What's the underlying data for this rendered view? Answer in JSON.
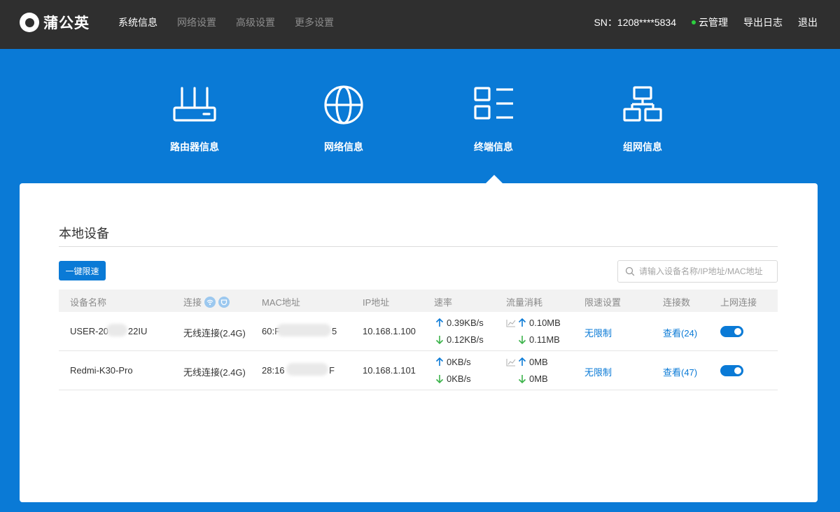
{
  "brand": {
    "name": "蒲公英"
  },
  "nav": [
    {
      "label": "系统信息",
      "active": true
    },
    {
      "label": "网络设置",
      "active": false
    },
    {
      "label": "高级设置",
      "active": false
    },
    {
      "label": "更多设置",
      "active": false
    }
  ],
  "top_right": {
    "sn": "SN：1208****5834",
    "cloud": "云管理",
    "export_log": "导出日志",
    "logout": "退出"
  },
  "categories": [
    {
      "label": "路由器信息",
      "icon": "router-icon"
    },
    {
      "label": "网络信息",
      "icon": "globe-icon"
    },
    {
      "label": "终端信息",
      "icon": "terminal-list-icon",
      "selected": true
    },
    {
      "label": "组网信息",
      "icon": "network-topology-icon"
    }
  ],
  "panel": {
    "title": "本地设备",
    "limit_button": "一键限速",
    "search_placeholder": "请输入设备名称/IP地址/MAC地址"
  },
  "table": {
    "headers": [
      "设备名称",
      "连接",
      "MAC地址",
      "IP地址",
      "速率",
      "流量消耗",
      "限速设置",
      "连接数",
      "上网连接"
    ],
    "rows": [
      {
        "name": "USER-20",
        "name_suffix": "22IU",
        "connection": "无线连接(2.4G)",
        "mac_prefix": "60:F",
        "mac_suffix": "5",
        "ip": "10.168.1.100",
        "rate_up": "0.39KB/s",
        "rate_down": "0.12KB/s",
        "traffic_up": "0.10MB",
        "traffic_down": "0.11MB",
        "limit": "无限制",
        "connections": "查看(24)",
        "online": true
      },
      {
        "name": "Redmi-K30-Pro",
        "name_suffix": "",
        "connection": "无线连接(2.4G)",
        "mac_prefix": "28:16",
        "mac_suffix": "F",
        "ip": "10.168.1.101",
        "rate_up": "0KB/s",
        "rate_down": "0KB/s",
        "traffic_up": "0MB",
        "traffic_down": "0MB",
        "limit": "无限制",
        "connections": "查看(47)",
        "online": true
      }
    ]
  },
  "colors": {
    "topbar": "#2f2f2f",
    "accent": "#0a7ad6",
    "up_arrow": "#0a7ad6",
    "down_arrow": "#3bb34a"
  }
}
